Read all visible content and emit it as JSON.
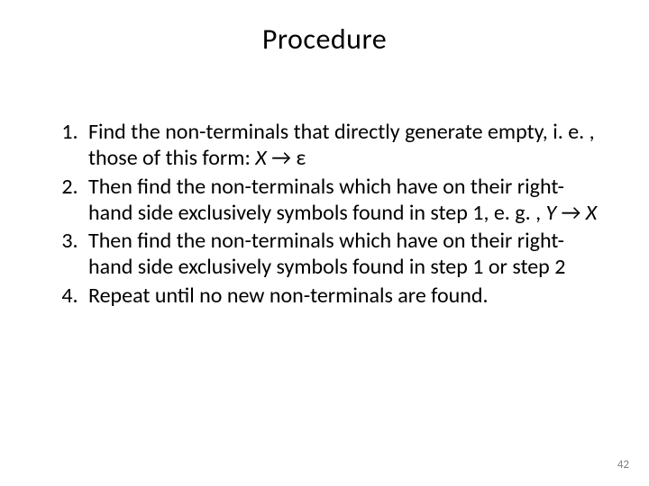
{
  "title": "Procedure",
  "steps": [
    {
      "prefix": "Find the non-terminals that directly generate empty, i. e. , those of this form: ",
      "italic": "X",
      "arrow": " → ε",
      "suffix": ""
    },
    {
      "prefix": "Then find the non-terminals which have on their right-hand side exclusively symbols found in step 1, e. g. , ",
      "italic": "Y",
      "arrow": " → ",
      "italic2": "X",
      "suffix": ""
    },
    {
      "prefix": "Then find the non-terminals which have on their right-hand side exclusively symbols found in step 1 or step 2",
      "italic": "",
      "arrow": "",
      "suffix": ""
    },
    {
      "prefix": "Repeat until no new non-terminals are found.",
      "italic": "",
      "arrow": "",
      "suffix": ""
    }
  ],
  "page_number": "42"
}
